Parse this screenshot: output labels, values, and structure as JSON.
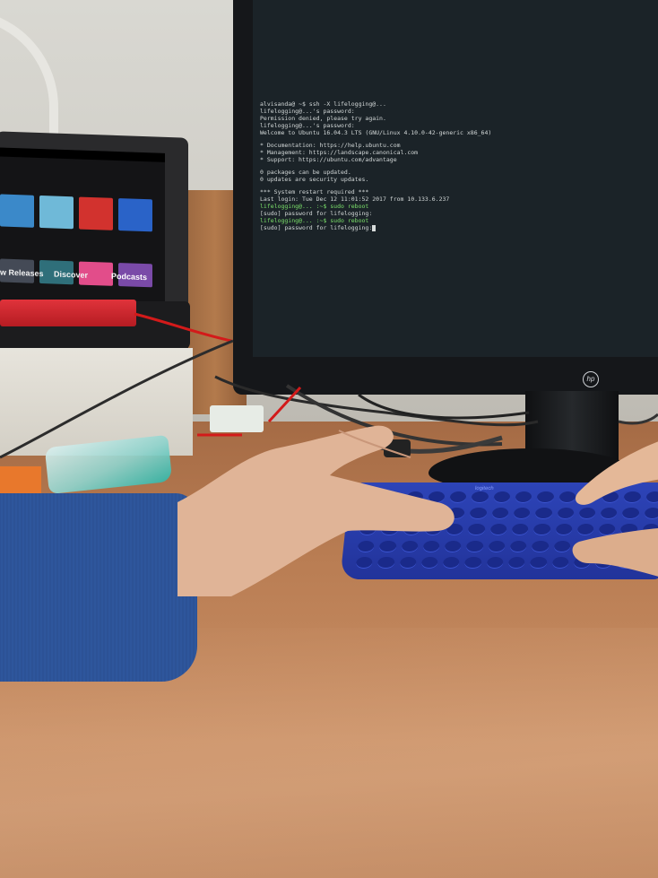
{
  "photo": {
    "laptop_screen": {
      "tiles_row1_colors": [
        "#3b89c9",
        "#6fb9d8",
        "#d2322e",
        "#2a63c8"
      ],
      "tiles_row2_colors": [
        "#444a56",
        "#2f6f7a",
        "#e24d8a",
        "#7a4aa8"
      ],
      "caption_left": "w Releases",
      "caption_mid": "Discover",
      "caption_right": "Podcasts"
    },
    "monitor": {
      "brand": "hp",
      "terminal_lines": [
        {
          "text": "alvisanda@ ~$ ssh -X lifelogging@...",
          "style": ""
        },
        {
          "text": "lifelogging@...'s password:",
          "style": ""
        },
        {
          "text": "Permission denied, please try again.",
          "style": ""
        },
        {
          "text": "lifelogging@...'s password:",
          "style": ""
        },
        {
          "text": "Welcome to Ubuntu 16.04.3 LTS (GNU/Linux 4.10.0-42-generic x86_64)",
          "style": ""
        },
        {
          "text": " * Documentation:  https://help.ubuntu.com",
          "style": ""
        },
        {
          "text": " * Management:     https://landscape.canonical.com",
          "style": ""
        },
        {
          "text": " * Support:        https://ubuntu.com/advantage",
          "style": ""
        },
        {
          "text": "0 packages can be updated.",
          "style": ""
        },
        {
          "text": "0 updates are security updates.",
          "style": ""
        },
        {
          "text": "*** System restart required ***",
          "style": ""
        },
        {
          "text": "Last login: Tue Dec 12 11:01:52 2017 from 10.133.6.237",
          "style": ""
        },
        {
          "text": "lifelogging@... :~$ sudo reboot",
          "style": "green"
        },
        {
          "text": "[sudo] password for lifelogging:",
          "style": ""
        },
        {
          "text": "lifelogging@... :~$ sudo reboot",
          "style": "green"
        },
        {
          "text": "[sudo] password for lifelogging:",
          "style": ""
        }
      ]
    },
    "keyboard": {
      "brand": "logitech",
      "color": "#2a3fb0"
    }
  }
}
